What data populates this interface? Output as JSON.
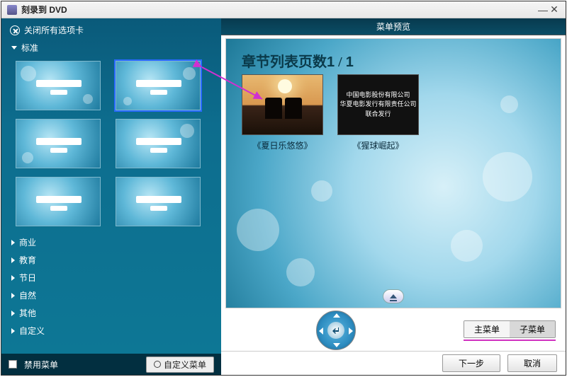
{
  "window": {
    "title": "刻录到 DVD"
  },
  "sidebar": {
    "close_all": "关闭所有选项卡",
    "categories": [
      "标准",
      "商业",
      "教育",
      "节日",
      "自然",
      "其他",
      "自定义"
    ],
    "disable_menu": "禁用菜单",
    "customize_menu": "自定义菜单"
  },
  "preview": {
    "header": "菜单预览",
    "title_prefix": "章节列表页数",
    "page_current": "1",
    "page_total": "1",
    "chapters": [
      {
        "caption": "《夏日乐悠悠》"
      },
      {
        "caption": "《猩球崛起》",
        "lines": [
          "中国电影股份有限公司",
          "华夏电影发行有限责任公司",
          "联合发行"
        ]
      }
    ]
  },
  "menu_tabs": {
    "main": "主菜单",
    "sub": "子菜单"
  },
  "footer": {
    "next": "下一步",
    "cancel": "取消"
  }
}
